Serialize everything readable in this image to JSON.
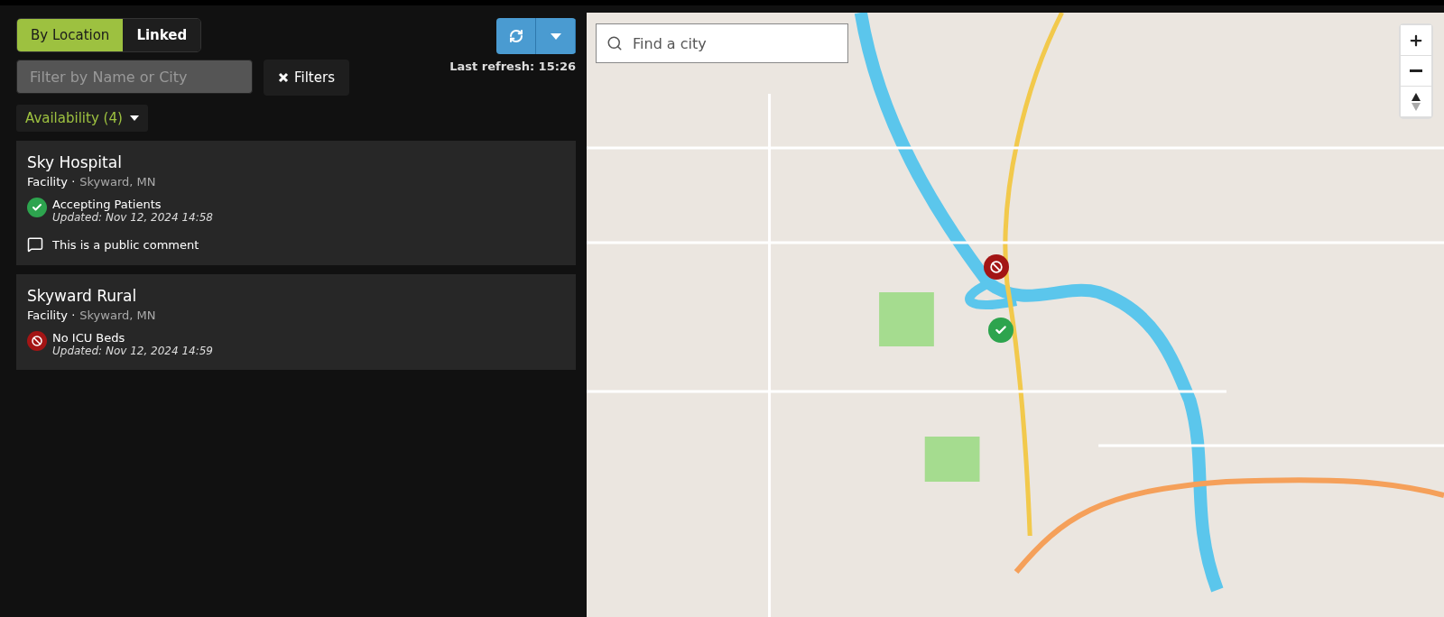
{
  "view_tabs": [
    {
      "label": "By Location",
      "selected": true
    },
    {
      "label": "Linked",
      "selected": false
    }
  ],
  "filter": {
    "placeholder": "Filter by Name or City"
  },
  "filters_button": "Filters",
  "availability_dropdown": "Availability (4)",
  "last_refresh": "Last refresh: 15:26",
  "facilities": [
    {
      "name": "Sky Hospital",
      "type": "Facility ·",
      "location": "Skyward, MN",
      "status": {
        "kind": "accepting",
        "label": "Accepting Patients",
        "updated": "Updated: Nov 12, 2024 14:58"
      },
      "comment": "This is a public comment"
    },
    {
      "name": "Skyward Rural",
      "type": "Facility ·",
      "location": "Skyward, MN",
      "status": {
        "kind": "closed",
        "label": "No ICU Beds",
        "updated": "Updated: Nov 12, 2024 14:59"
      }
    }
  ],
  "map": {
    "search_placeholder": "Find a city",
    "markers": [
      {
        "kind": "closed"
      },
      {
        "kind": "accepting"
      }
    ]
  }
}
